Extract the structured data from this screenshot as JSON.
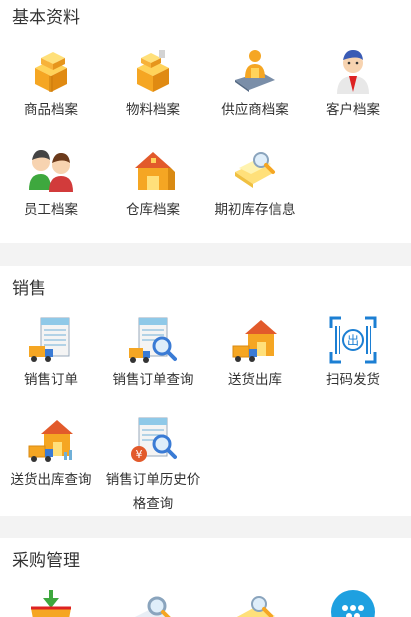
{
  "sections": {
    "basic": {
      "title": "基本资料",
      "items": [
        {
          "label": "商品档案",
          "icon": "boxes-icon"
        },
        {
          "label": "物料档案",
          "icon": "boxes-icon"
        },
        {
          "label": "供应商档案",
          "icon": "supplier-person-icon"
        },
        {
          "label": "客户档案",
          "icon": "customer-person-icon"
        },
        {
          "label": "员工档案",
          "icon": "employees-icon"
        },
        {
          "label": "仓库档案",
          "icon": "warehouse-icon"
        },
        {
          "label": "期初库存信息",
          "icon": "folder-search-icon"
        }
      ]
    },
    "sales": {
      "title": "销售",
      "items": [
        {
          "label": "销售订单",
          "icon": "truck-sheet-icon"
        },
        {
          "label": "销售订单查询",
          "icon": "truck-sheet-search-icon"
        },
        {
          "label": "送货出库",
          "icon": "truck-house-icon"
        },
        {
          "label": "扫码发货",
          "icon": "scan-barcode-icon",
          "badge": "出"
        },
        {
          "label": "送货出库查询",
          "icon": "truck-house-search-icon"
        },
        {
          "label": "销售订单历史价格查询",
          "icon": "price-sheet-search-icon",
          "badge": "¥"
        }
      ]
    },
    "purchase": {
      "title": "采购管理",
      "items": [
        {
          "label": "",
          "icon": "basket-icon"
        },
        {
          "label": "",
          "icon": "search-icon"
        },
        {
          "label": "",
          "icon": "folder-search-icon"
        },
        {
          "label": "",
          "icon": "more-icon"
        }
      ]
    }
  },
  "colors": {
    "background": "#f3f3f3",
    "card": "#ffffff",
    "text": "#333333",
    "accent_blue": "#1c7fd3",
    "accent_orange": "#f5a623"
  }
}
